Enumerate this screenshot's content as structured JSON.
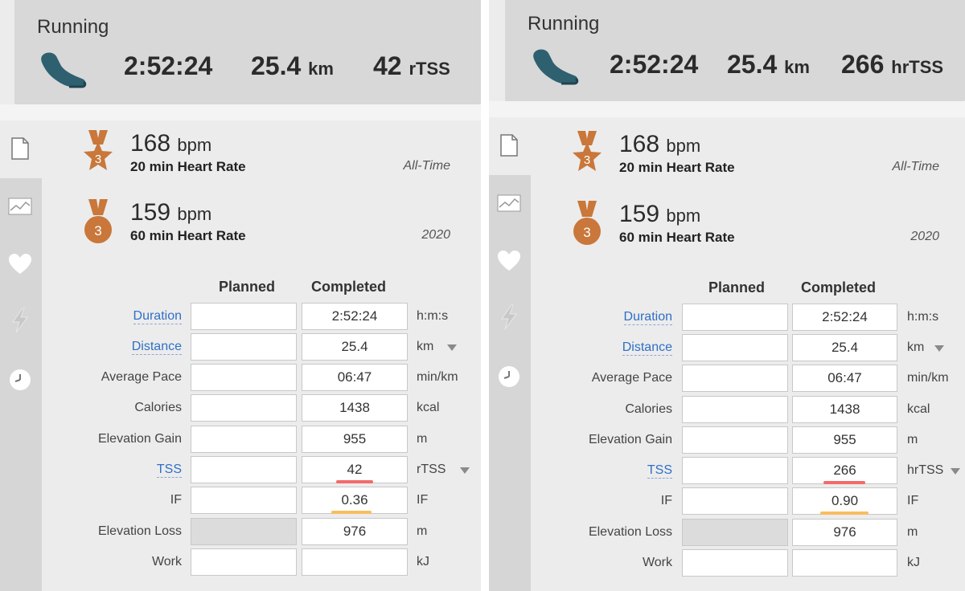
{
  "panels": [
    {
      "sport": "Running",
      "summary": {
        "duration": "2:52:24",
        "distance": "25.4",
        "distance_unit": "km",
        "tss": "42",
        "tss_unit": "rTSS"
      },
      "records": [
        {
          "value": "168",
          "unit": "bpm",
          "label": "20 min Heart Rate",
          "period": "All-Time",
          "rank": "3"
        },
        {
          "value": "159",
          "unit": "bpm",
          "label": "60 min Heart Rate",
          "period": "2020",
          "rank": "3"
        }
      ],
      "columns": {
        "planned": "Planned",
        "completed": "Completed"
      },
      "rows": [
        {
          "label": "Duration",
          "completed": "2:52:24",
          "unit": "h:m:s"
        },
        {
          "label": "Distance",
          "completed": "25.4",
          "unit": "km"
        },
        {
          "label": "Average Pace",
          "completed": "06:47",
          "unit": "min/km"
        },
        {
          "label": "Calories",
          "completed": "1438",
          "unit": "kcal"
        },
        {
          "label": "Elevation Gain",
          "completed": "955",
          "unit": "m"
        },
        {
          "label": "TSS",
          "completed": "42",
          "unit": "rTSS"
        },
        {
          "label": "IF",
          "completed": "0.36",
          "unit": "IF"
        },
        {
          "label": "Elevation Loss",
          "completed": "976",
          "unit": "m"
        },
        {
          "label": "Work",
          "completed": "",
          "unit": "kJ"
        }
      ]
    },
    {
      "sport": "Running",
      "summary": {
        "duration": "2:52:24",
        "distance": "25.4",
        "distance_unit": "km",
        "tss": "266",
        "tss_unit": "hrTSS"
      },
      "records": [
        {
          "value": "168",
          "unit": "bpm",
          "label": "20 min Heart Rate",
          "period": "All-Time",
          "rank": "3"
        },
        {
          "value": "159",
          "unit": "bpm",
          "label": "60 min Heart Rate",
          "period": "2020",
          "rank": "3"
        }
      ],
      "columns": {
        "planned": "Planned",
        "completed": "Completed"
      },
      "rows": [
        {
          "label": "Duration",
          "completed": "2:52:24",
          "unit": "h:m:s"
        },
        {
          "label": "Distance",
          "completed": "25.4",
          "unit": "km"
        },
        {
          "label": "Average Pace",
          "completed": "06:47",
          "unit": "min/km"
        },
        {
          "label": "Calories",
          "completed": "1438",
          "unit": "kcal"
        },
        {
          "label": "Elevation Gain",
          "completed": "955",
          "unit": "m"
        },
        {
          "label": "TSS",
          "completed": "266",
          "unit": "hrTSS"
        },
        {
          "label": "IF",
          "completed": "0.90",
          "unit": "IF"
        },
        {
          "label": "Elevation Loss",
          "completed": "976",
          "unit": "m"
        },
        {
          "label": "Work",
          "completed": "",
          "unit": "kJ"
        }
      ]
    }
  ],
  "icons": {
    "sport": "running-shoe-icon",
    "sidebar": [
      "document-icon",
      "chart-icon",
      "heart-icon",
      "lightning-icon",
      "clock-icon"
    ],
    "medal_top": "star-medal-icon",
    "medal_bottom": "round-medal-icon"
  },
  "colors": {
    "medal": "#c9773a",
    "link": "#2f6fc7",
    "shoe": "#2e6070",
    "underline_red": "#f26b6b",
    "underline_orange": "#f7be5e"
  }
}
